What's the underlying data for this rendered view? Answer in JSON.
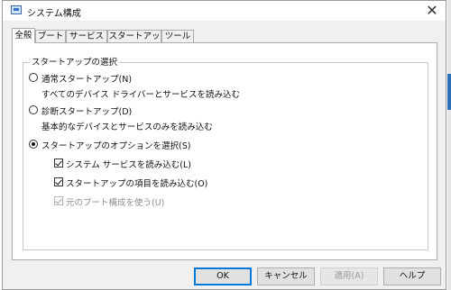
{
  "window": {
    "title": "システム構成",
    "close_glyph": "✕"
  },
  "tabs": [
    {
      "label": "全般",
      "active": true
    },
    {
      "label": "ブート",
      "active": false
    },
    {
      "label": "サービス",
      "active": false
    },
    {
      "label": "スタートアップ",
      "active": false
    },
    {
      "label": "ツール",
      "active": false
    }
  ],
  "startup_group": {
    "title": "スタートアップの選択",
    "normal": {
      "label": "通常スタートアップ(N)",
      "description": "すべてのデバイス ドライバーとサービスを読み込む",
      "selected": false
    },
    "diagnostic": {
      "label": "診断スタートアップ(D)",
      "description": "基本的なデバイスとサービスのみを読み込む",
      "selected": false
    },
    "selective": {
      "label": "スタートアップのオプションを選択(S)",
      "selected": true,
      "options": [
        {
          "label": "システム サービスを読み込む(L)",
          "checked": true,
          "enabled": true
        },
        {
          "label": "スタートアップの項目を読み込む(O)",
          "checked": true,
          "enabled": true
        },
        {
          "label": "元のブート構成を使う(U)",
          "checked": true,
          "enabled": false
        }
      ]
    }
  },
  "buttons": {
    "ok": "OK",
    "cancel": "キャンセル",
    "apply": "適用(A)",
    "help": "ヘルプ"
  }
}
